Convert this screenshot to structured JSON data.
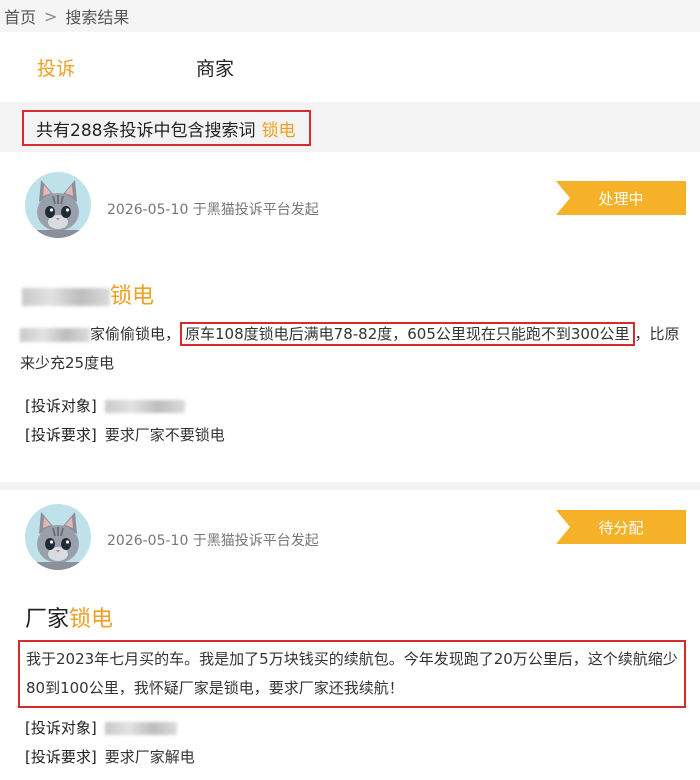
{
  "breadcrumb": {
    "home": "首页",
    "separator": ">",
    "current": "搜索结果"
  },
  "tabs": [
    {
      "label": "投诉",
      "active": true
    },
    {
      "label": "商家",
      "active": false
    }
  ],
  "summary": {
    "text": "共有288条投诉中包含搜索词",
    "keyword": "锁电"
  },
  "complaints": [
    {
      "meta": "2026-05-10 于黑猫投诉平台发起",
      "status": "处理中",
      "title_keyword": "锁电",
      "content_prefix": "家偷偷锁电，",
      "content_highlight": "原车108度锁电后满电78-82度，605公里现在只能跑不到300公里",
      "content_suffix": "，比原来少充25度电",
      "target_label": "[投诉对象]",
      "request_label": "[投诉要求]",
      "request": "要求厂家不要锁电"
    },
    {
      "meta": "2026-05-10 于黑猫投诉平台发起",
      "status": "待分配",
      "title_prefix": "厂家",
      "title_keyword": "锁电",
      "content": "我于2023年七月买的车。我是加了5万块钱买的续航包。今年发现跑了20万公里后，这个续航缩少80到100公里，我怀疑厂家是锁电，要求厂家还我续航！",
      "target_label": "[投诉对象]",
      "request_label": "[投诉要求]",
      "request": "要求厂家解电"
    }
  ],
  "colors": {
    "accent": "#f0a020",
    "badge": "#f5b127",
    "highlight_border": "#d42b2b"
  },
  "icons": {
    "avatar": "cat-avatar-icon"
  }
}
